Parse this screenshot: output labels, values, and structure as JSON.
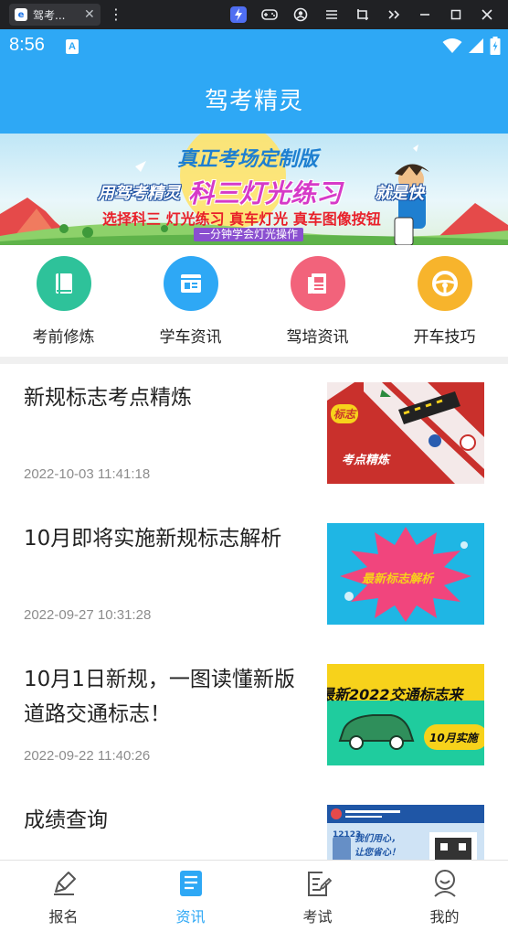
{
  "emulator": {
    "tab_title": "驾考...",
    "tab_icon_letter": "e",
    "close_glyph": "✕",
    "menu_glyph": "⋮",
    "toolbar_icons": [
      "lightning-icon",
      "gamepad-icon",
      "account-icon",
      "menu-icon",
      "crop-icon",
      "double-chevron-icon",
      "minimize-icon",
      "maximize-icon",
      "close-icon"
    ]
  },
  "status_bar": {
    "time": "8:56",
    "notification_letter": "A"
  },
  "app": {
    "title": "驾考精灵"
  },
  "banner": {
    "line1": "真正考场定制版",
    "line2_prefix": "用驾考精灵",
    "line2_highlight": "科三灯光练习",
    "line2_suffix": "就是快",
    "line3": "选择科三 灯光练习 真车灯光 真车图像按钮",
    "line4": "一分钟学会灯光操作"
  },
  "menu": [
    {
      "label": "考前修炼",
      "color": "#2ec29a",
      "icon": "book-icon"
    },
    {
      "label": "学车资讯",
      "color": "#2ea8f5",
      "icon": "newsletter-icon"
    },
    {
      "label": "驾培资讯",
      "color": "#f2637b",
      "icon": "newspaper-icon"
    },
    {
      "label": "开车技巧",
      "color": "#f7b42c",
      "icon": "steering-wheel-icon"
    }
  ],
  "news": [
    {
      "title": "新规标志考点精炼",
      "date": "2022-10-03 11:41:18",
      "thumb_text": "考点精炼",
      "thumb_tag": "标志"
    },
    {
      "title": "10月即将实施新规标志解析",
      "date": "2022-09-27 10:31:28",
      "thumb_text": "最新标志解析"
    },
    {
      "title": "10月1日新规，一图读懂新版道路交通标志！",
      "date": "2022-09-22 11:40:26",
      "thumb_text": "最新2022交通标志来",
      "thumb_tag": "10月实施"
    },
    {
      "title": "成绩查询",
      "date": "",
      "thumb_text": "我们用心，让您省心！",
      "thumb_tag": "12123"
    }
  ],
  "bottom_nav": [
    {
      "label": "报名",
      "icon": "pen-icon",
      "active": false
    },
    {
      "label": "资讯",
      "icon": "document-icon",
      "active": true
    },
    {
      "label": "考试",
      "icon": "exam-icon",
      "active": false
    },
    {
      "label": "我的",
      "icon": "profile-icon",
      "active": false
    }
  ],
  "colors": {
    "primary": "#2ea8f5",
    "nav_active": "#2ea8f5",
    "text_primary": "#222222",
    "text_secondary": "#8c8c8c"
  }
}
